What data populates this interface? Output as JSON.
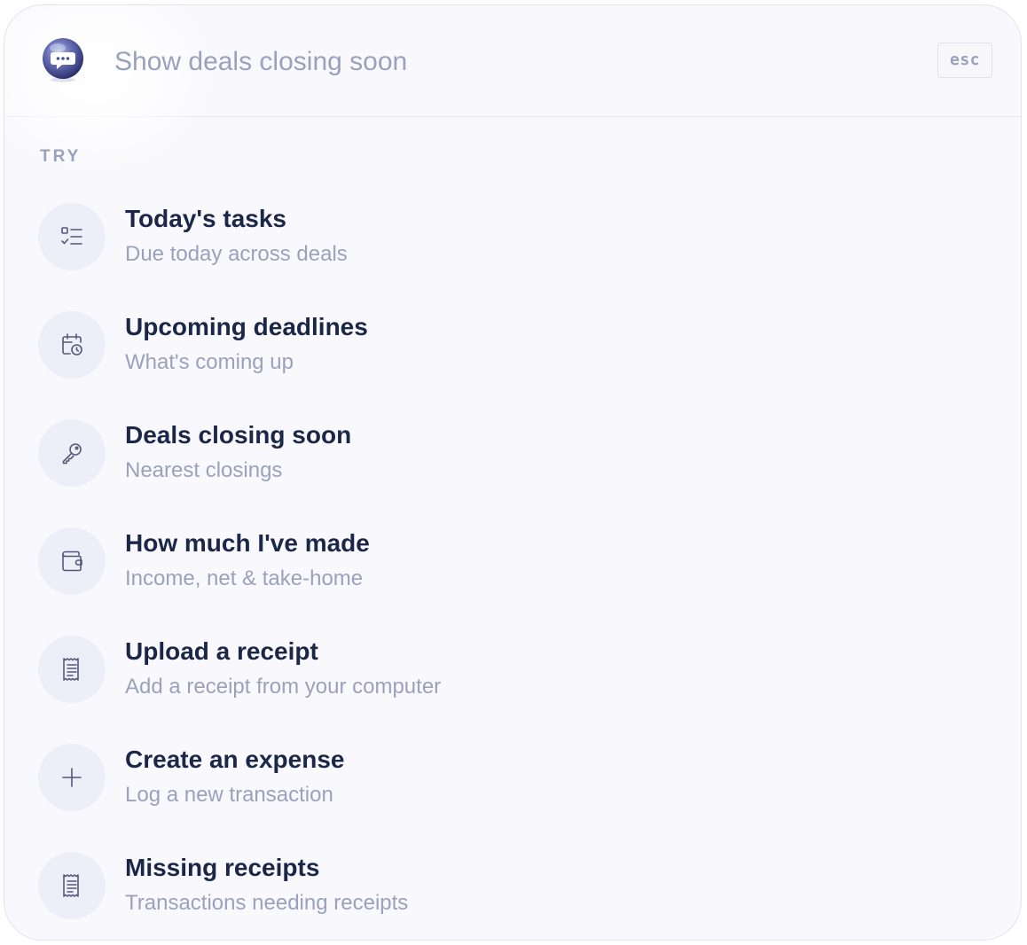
{
  "search": {
    "placeholder": "Show deals closing soon",
    "esc_label": "esc"
  },
  "section_label": "TRY",
  "suggestions": [
    {
      "title": "Today's tasks",
      "subtitle": "Due today across deals",
      "icon": "checklist-icon"
    },
    {
      "title": "Upcoming deadlines",
      "subtitle": "What's coming up",
      "icon": "calendar-clock-icon"
    },
    {
      "title": "Deals closing soon",
      "subtitle": "Nearest closings",
      "icon": "key-icon"
    },
    {
      "title": "How much I've made",
      "subtitle": "Income, net & take-home",
      "icon": "wallet-icon"
    },
    {
      "title": "Upload a receipt",
      "subtitle": "Add a receipt from your computer",
      "icon": "receipt-icon"
    },
    {
      "title": "Create an expense",
      "subtitle": "Log a new transaction",
      "icon": "plus-icon"
    },
    {
      "title": "Missing receipts",
      "subtitle": "Transactions needing receipts",
      "icon": "receipt-icon"
    }
  ],
  "colors": {
    "title": "#1b2748",
    "muted": "#9aa1bd",
    "icon_bg": "#eceef8",
    "panel_bg": "#f9f9fd"
  }
}
